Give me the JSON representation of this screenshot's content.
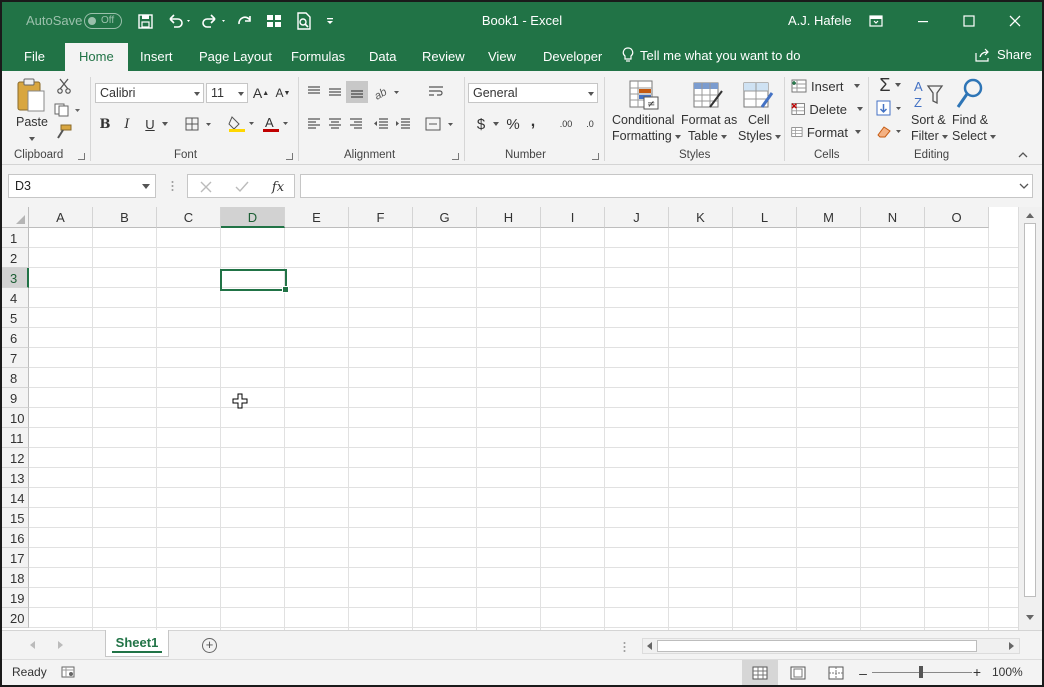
{
  "titlebar": {
    "autosave_label": "AutoSave",
    "autosave_state": "Off",
    "title": "Book1  -  Excel",
    "user": "A.J. Hafele"
  },
  "tabs": [
    {
      "label": "File"
    },
    {
      "label": "Home"
    },
    {
      "label": "Insert"
    },
    {
      "label": "Page Layout"
    },
    {
      "label": "Formulas"
    },
    {
      "label": "Data"
    },
    {
      "label": "Review"
    },
    {
      "label": "View"
    },
    {
      "label": "Developer"
    }
  ],
  "active_tab": "Home",
  "tell_me": "Tell me what you want to do",
  "share": "Share",
  "ribbon": {
    "clipboard": {
      "label": "Clipboard",
      "paste": "Paste"
    },
    "font": {
      "label": "Font",
      "name": "Calibri",
      "size": "11",
      "bold": "B",
      "italic": "I",
      "underline": "U",
      "font_color_letter": "A",
      "grow": "A",
      "shrink": "A",
      "highlight_color": "#ffd700",
      "font_color": "#c00000"
    },
    "alignment": {
      "label": "Alignment"
    },
    "number": {
      "label": "Number",
      "format": "General",
      "currency": "$",
      "percent": "%",
      "comma": ",",
      "inc_decimal": ".00",
      "dec_decimal": ".0"
    },
    "styles": {
      "label": "Styles",
      "conditional_line1": "Conditional",
      "conditional_line2": "Formatting",
      "format_table_line1": "Format as",
      "format_table_line2": "Table",
      "cell_styles_line1": "Cell",
      "cell_styles_line2": "Styles"
    },
    "cells": {
      "label": "Cells",
      "insert": "Insert",
      "delete": "Delete",
      "format": "Format"
    },
    "editing": {
      "label": "Editing",
      "autosum": "Σ",
      "sort_line1": "Sort &",
      "sort_line2": "Filter",
      "find_line1": "Find &",
      "find_line2": "Select",
      "sort_letters": "AZ"
    }
  },
  "formula_bar": {
    "name_box": "D3",
    "fx": "fx",
    "formula": ""
  },
  "grid": {
    "columns": [
      "A",
      "B",
      "C",
      "D",
      "E",
      "F",
      "G",
      "H",
      "I",
      "J",
      "K",
      "L",
      "M",
      "N",
      "O"
    ],
    "rows": [
      "1",
      "2",
      "3",
      "4",
      "5",
      "6",
      "7",
      "8",
      "9",
      "10",
      "11",
      "12",
      "13",
      "14",
      "15",
      "16",
      "17",
      "18",
      "19",
      "20"
    ],
    "active_cell": "D3",
    "active_column": "D",
    "active_row": "3"
  },
  "sheets": [
    {
      "name": "Sheet1",
      "active": true
    }
  ],
  "status": {
    "ready": "Ready",
    "zoom": "100%"
  },
  "colors": {
    "accent": "#217346",
    "selected_header": "#d2d2d2",
    "gridline": "#e1e1e1"
  }
}
